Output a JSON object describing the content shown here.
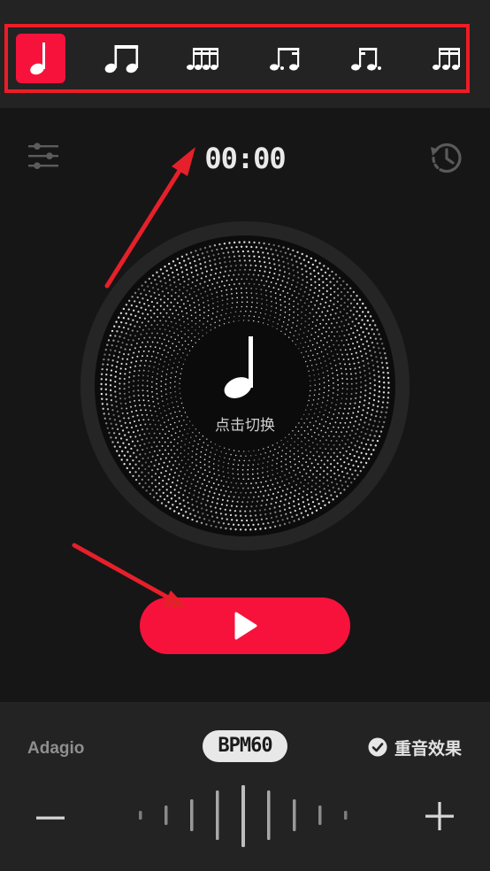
{
  "rhythms": [
    {
      "icon": "quarter-note-icon",
      "selected": true
    },
    {
      "icon": "eighth-notes-icon",
      "selected": false
    },
    {
      "icon": "sixteenth-notes-icon",
      "selected": false
    },
    {
      "icon": "dotted-eighth-sixteenth-icon",
      "selected": false
    },
    {
      "icon": "sixteenth-dotted-eighth-icon",
      "selected": false
    },
    {
      "icon": "triplet-notes-icon",
      "selected": false
    }
  ],
  "timer": {
    "display": "00:00"
  },
  "dial": {
    "hint": "点击切换",
    "icon": "quarter-note-icon"
  },
  "tempo": {
    "name": "Adagio",
    "bpm_label": "BPM60",
    "bpm": 60
  },
  "accent": {
    "label": "重音效果",
    "checked": true
  },
  "icons": {
    "mixer": "sliders-icon",
    "history": "history-icon",
    "play": "play-icon",
    "minus": "minus-icon",
    "plus": "plus-icon",
    "check": "check-circle-icon"
  },
  "colors": {
    "accent": "#f7123b",
    "highlight_frame": "#ee1c25",
    "background": "#161616",
    "panel": "#232323"
  }
}
